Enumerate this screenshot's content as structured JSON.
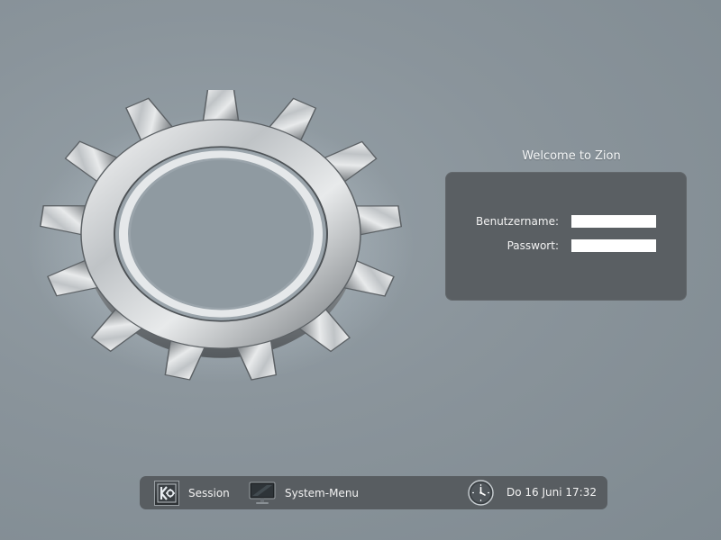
{
  "welcome": {
    "title": "Welcome to Zion"
  },
  "login": {
    "username_label": "Benutzername:",
    "username_value": "",
    "password_label": "Passwort:",
    "password_value": ""
  },
  "taskbar": {
    "session_label": "Session",
    "system_menu_label": "System-Menu",
    "datetime": "Do 16 Juni 17:32"
  },
  "icons": {
    "background_logo": "gear-icon",
    "session": "kde-logo-icon",
    "system_menu": "monitor-icon",
    "clock": "clock-icon"
  },
  "colors": {
    "background": "#8a949b",
    "panel": "#5a5f63",
    "taskbar": "#585d61",
    "text": "#ffffff"
  }
}
